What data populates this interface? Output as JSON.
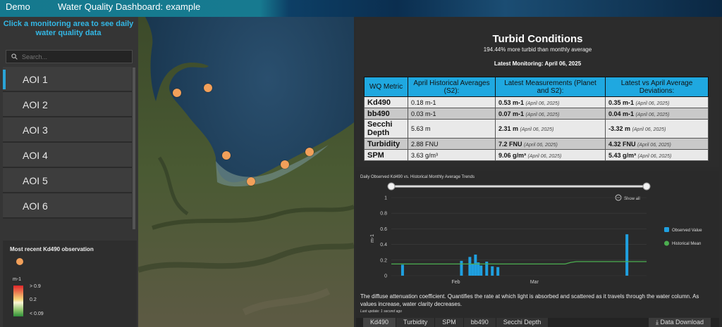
{
  "header": {
    "app_name": "Demo",
    "dashboard_title": "Water Quality Dashboard:",
    "dashboard_subtitle": "example"
  },
  "sidebar": {
    "prompt": "Click a monitoring area to see daily water quality data",
    "search_placeholder": "Search...",
    "aoi_items": [
      "AOI 1",
      "AOI 2",
      "AOI 3",
      "AOI 4",
      "AOI 5",
      "AOI 6"
    ],
    "selected_index": 0
  },
  "legend": {
    "title": "Most recent Kd490 observation",
    "unit": "m-1",
    "labels": [
      "> 0.9",
      "0.2",
      "< 0.09"
    ]
  },
  "summary": {
    "title": "Turbid Conditions",
    "subtitle": "194.44% more turbid than monthly average",
    "latest": "Latest Monitoring: April 06, 2025"
  },
  "table": {
    "headers": [
      "WQ Metric",
      "April Historical Averages (S2):",
      "Latest Measurements (Planet and S2):",
      "Latest vs April Average Deviations:"
    ],
    "rows": [
      {
        "metric": "Kd490",
        "hist": "0.18 m-1",
        "latest": "0.53 m-1",
        "latest_date": "(April 06, 2025)",
        "dev": "0.35 m-1",
        "dev_date": "(April 06, 2025)"
      },
      {
        "metric": "bb490",
        "hist": "0.03 m-1",
        "latest": "0.07 m-1",
        "latest_date": "(April 06, 2025)",
        "dev": "0.04 m-1",
        "dev_date": "(April 06, 2025)"
      },
      {
        "metric": "Secchi Depth",
        "hist": "5.63 m",
        "latest": "2.31 m",
        "latest_date": "(April 06, 2025)",
        "dev": "-3.32 m",
        "dev_date": "(April 06, 2025)"
      },
      {
        "metric": "Turbidity",
        "hist": "2.88 FNU",
        "latest": "7.2 FNU",
        "latest_date": "(April 06, 2025)",
        "dev": "4.32 FNU",
        "dev_date": "(April 06, 2025)"
      },
      {
        "metric": "SPM",
        "hist": "3.63 g/m³",
        "latest": "9.06 g/m³",
        "latest_date": "(April 06, 2025)",
        "dev": "5.43 g/m³",
        "dev_date": "(April 06, 2025)"
      }
    ]
  },
  "chart": {
    "title": "Daily Observed Kd490 vs. Historical Monthly Average Trends",
    "show_all": "Show all",
    "description": "The diffuse attenuation coefficient. Quantifies the rate at which light is absorbed and scattered as it travels through the water column. As values increase, water clarity decreases.",
    "last_update": "Last update: 1 second ago"
  },
  "chart_data": {
    "type": "bar",
    "ylabel": "m-1",
    "ylim": [
      0,
      1
    ],
    "yticks": [
      0,
      0.2,
      0.4,
      0.6,
      0.8,
      1
    ],
    "xticks": [
      {
        "label": "Feb",
        "day": 35
      },
      {
        "label": "Mar",
        "day": 63
      }
    ],
    "xlim": [
      12,
      103
    ],
    "series": [
      {
        "name": "Observed Value",
        "color": "#1fa0e0",
        "x": [
          16,
          37,
          40,
          41,
          42,
          43,
          44,
          46,
          48,
          50,
          96
        ],
        "values": [
          0.14,
          0.19,
          0.24,
          0.15,
          0.27,
          0.17,
          0.13,
          0.18,
          0.12,
          0.11,
          0.53
        ]
      },
      {
        "name": "Historical Mean",
        "color": "#4caf50",
        "x": [
          12,
          74,
          76,
          78,
          103
        ],
        "values": [
          0.15,
          0.15,
          0.17,
          0.18,
          0.18
        ]
      }
    ],
    "legend_position": "right"
  },
  "tabs": [
    "Kd490",
    "Turbidity",
    "SPM",
    "bb490",
    "Secchi Depth"
  ],
  "download_label": "Data Download",
  "colors": {
    "accent": "#1fa8e0",
    "marker": "#f2a05a"
  }
}
